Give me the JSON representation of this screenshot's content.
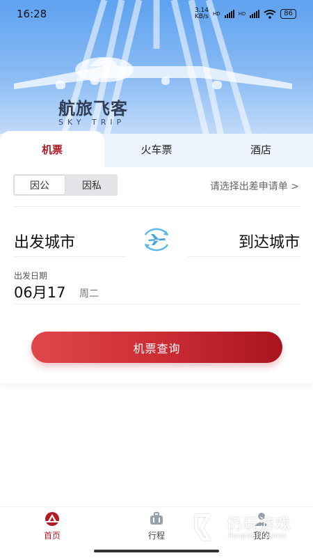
{
  "status_bar": {
    "time": "16:28",
    "speed_value": "3.14",
    "speed_unit": "KB/s",
    "hd1": "HD",
    "hd2": "HD",
    "battery": "86"
  },
  "brand": {
    "name": "航旅飞客",
    "tagline": "SKY TRIP"
  },
  "tabs": [
    {
      "label": "机票",
      "active": true
    },
    {
      "label": "火车票",
      "active": false
    },
    {
      "label": "酒店",
      "active": false
    }
  ],
  "trip_type": {
    "options": [
      "因公",
      "因私"
    ],
    "selected": "因公"
  },
  "apply_link": "请选择出差申请单 >",
  "from_city": "出发城市",
  "to_city": "到达城市",
  "date": {
    "label": "出发日期",
    "value": "06月17",
    "weekday": "周二"
  },
  "search_button": "机票查询",
  "bottom_nav": [
    {
      "label": "首页",
      "icon": "plane-home-icon",
      "active": true
    },
    {
      "label": "行程",
      "icon": "luggage-icon",
      "active": false
    },
    {
      "label": "我的",
      "icon": "user-icon",
      "active": false
    }
  ],
  "watermark": {
    "cn": "仍玩游戏",
    "en": "Rengwan Games"
  },
  "colors": {
    "accent": "#b01c25",
    "button_gradient_start": "#e0474c",
    "button_gradient_end": "#a8141f",
    "hero_top": "#5ea2f0"
  }
}
